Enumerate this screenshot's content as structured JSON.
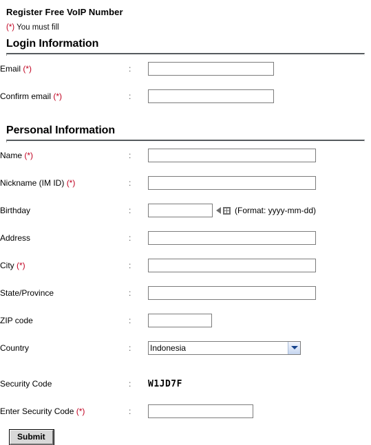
{
  "page": {
    "title": "Register Free VoIP Number",
    "required_note_marker": "(*)",
    "required_note_text": " You must fill"
  },
  "sections": [
    {
      "heading": "Login Information"
    },
    {
      "heading": "Personal Information"
    }
  ],
  "login_fields": [
    {
      "label": "Email ",
      "required": "(*)",
      "colon": ":",
      "value": "",
      "placeholder": ""
    },
    {
      "label": "Confirm email ",
      "required": "(*)",
      "colon": ":",
      "value": "",
      "placeholder": ""
    }
  ],
  "personal_fields": [
    {
      "label": "Name ",
      "required": "(*)",
      "colon": ":",
      "value": "",
      "placeholder": ""
    },
    {
      "label": "Nickname (IM ID) ",
      "required": "(*)",
      "colon": ":",
      "value": "",
      "placeholder": ""
    },
    {
      "label": "Birthday",
      "required": "",
      "colon": ":",
      "value": "",
      "placeholder": "",
      "hint": "(Format: yyyy-mm-dd)"
    },
    {
      "label": "Address",
      "required": "",
      "colon": ":",
      "value": "",
      "placeholder": ""
    },
    {
      "label": "City ",
      "required": "(*)",
      "colon": ":",
      "value": "",
      "placeholder": ""
    },
    {
      "label": "State/Province",
      "required": "",
      "colon": ":",
      "value": "",
      "placeholder": ""
    },
    {
      "label": "ZIP code",
      "required": "",
      "colon": ":",
      "value": "",
      "placeholder": ""
    },
    {
      "label": "Country",
      "required": "",
      "colon": ":",
      "selected": "Indonesia"
    }
  ],
  "country_options": [
    "Indonesia"
  ],
  "security": {
    "code_label": "Security Code",
    "code_colon": ":",
    "code_value": "W1JD7F",
    "entry_label": "Enter Security Code ",
    "entry_required": "(*)",
    "entry_colon": ":",
    "entry_value": "",
    "entry_placeholder": ""
  },
  "submit": {
    "label": "Submit"
  },
  "colors": {
    "required_red": "#c00020",
    "rule_gray": "#555a5e",
    "input_border": "#7b7b7b",
    "button_face": "#d8d8d8",
    "select_arrow_blue": "#15428b"
  }
}
